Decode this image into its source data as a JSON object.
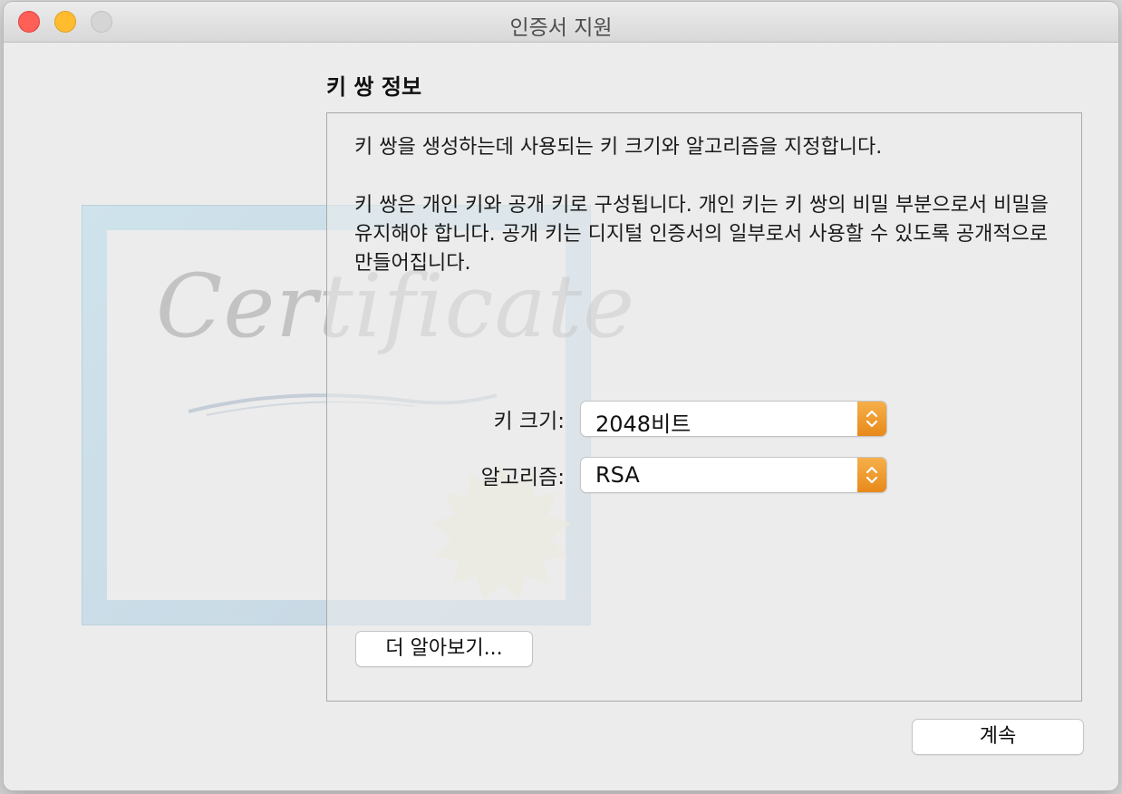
{
  "window": {
    "title": "인증서 지원"
  },
  "decoration": {
    "certificate_word": "Certificate"
  },
  "section": {
    "title": "키 쌍 정보"
  },
  "description": {
    "paragraph1": "키 쌍을 생성하는데 사용되는 키 크기와 알고리즘을 지정합니다.",
    "paragraph2": "키 쌍은 개인 키와 공개 키로 구성됩니다. 개인 키는 키 쌍의 비밀 부분으로서 비밀을 유지해야 합니다. 공개 키는 디지털 인증서의 일부로서 사용할 수 있도록 공개적으로 만들어집니다."
  },
  "fields": {
    "key_size": {
      "label": "키 크기:",
      "value": "2048비트"
    },
    "algorithm": {
      "label": "알고리즘:",
      "value": "RSA"
    }
  },
  "buttons": {
    "learn_more": "더 알아보기...",
    "continue": "계속"
  },
  "colors": {
    "close": "#fe5f57",
    "minimize": "#febc2e",
    "zoom_disabled": "#d5d5d5",
    "popup_accent": "#e8891a"
  }
}
